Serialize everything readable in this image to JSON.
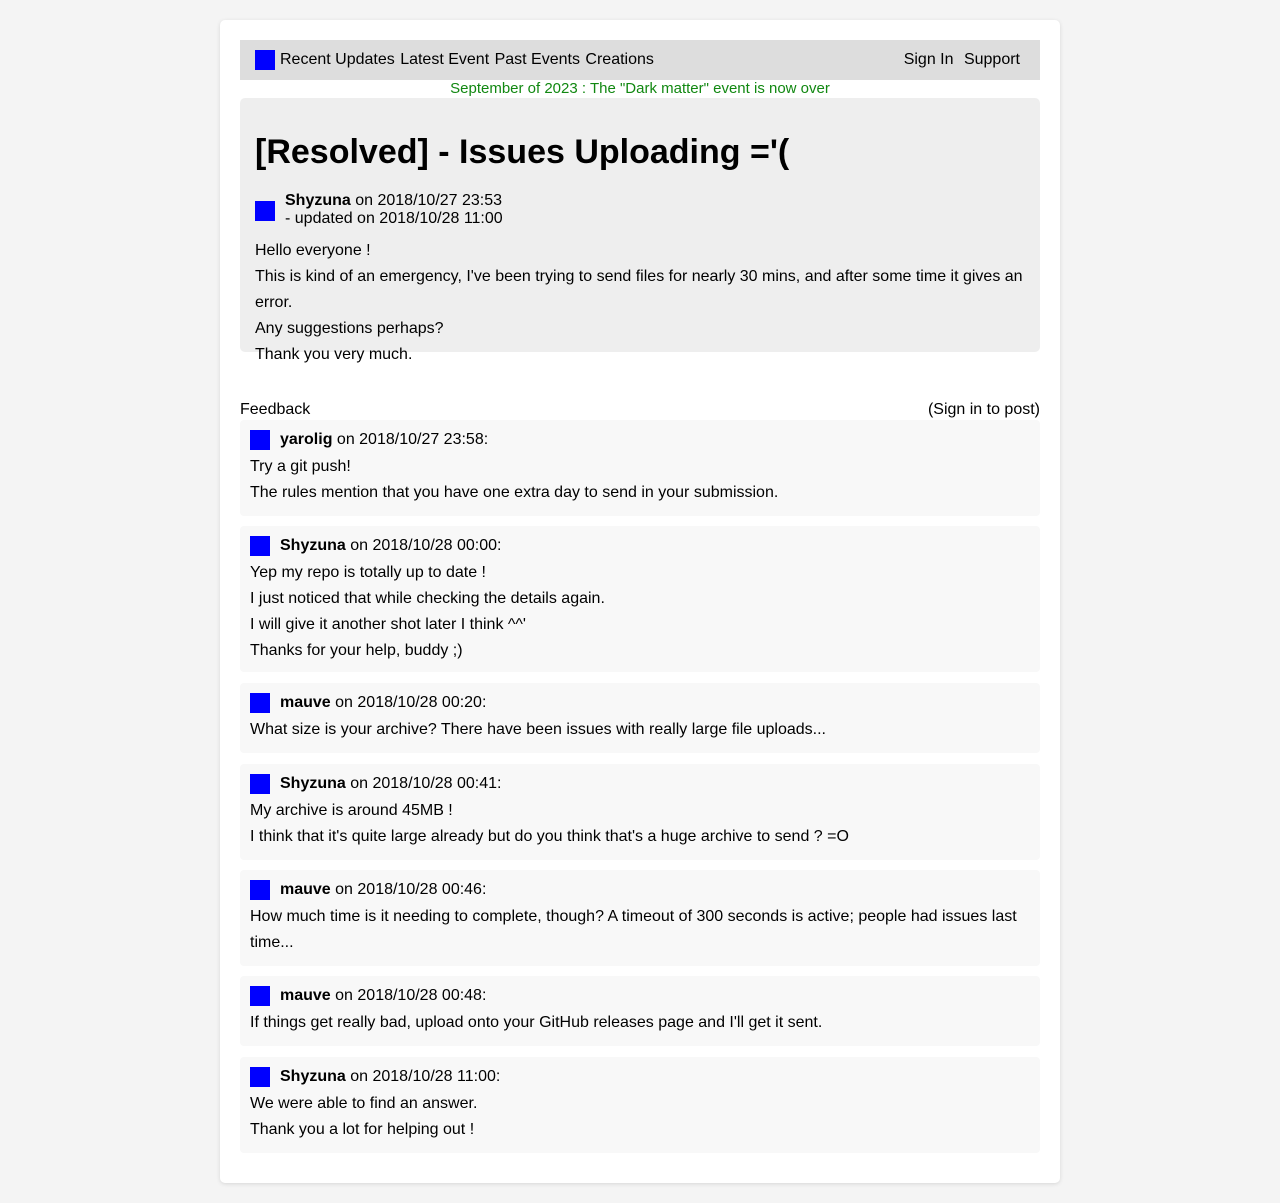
{
  "nav": {
    "links": [
      "Recent Updates",
      "Latest Event",
      "Past Events",
      "Creations"
    ],
    "right": [
      "Sign In",
      "Support"
    ],
    "logo_icon": "site-logo-square",
    "colors": {
      "bar": "#dddddd",
      "logo": "#0000ff"
    }
  },
  "banner": {
    "text": "September of 2023 : The \"Dark matter\" event is now over",
    "color": "#118811"
  },
  "post": {
    "title": "[Resolved] - Issues Uploading ='(",
    "author": "Shyzuna",
    "posted": " on 2018/10/27 23:53",
    "updated": "- updated on 2018/10/28 11:00",
    "body": [
      "Hello everyone !",
      "This is kind of an emergency, I've been trying to send files for nearly 30 mins, and after some time it gives an error.",
      "Any suggestions perhaps?",
      "Thank you very much."
    ]
  },
  "feedback": {
    "label": "Feedback",
    "sign_in": "(Sign in to post)"
  },
  "comments": [
    {
      "author": "yarolig",
      "meta": " on 2018/10/27 23:58:",
      "lines": [
        "Try a git push!",
        "The rules mention that you have one extra day to send in your submission."
      ]
    },
    {
      "author": "Shyzuna",
      "meta": " on 2018/10/28 00:00:",
      "lines": [
        "Yep my repo is totally up to date !",
        "I just noticed that while checking the details again.",
        "I will give it another shot later I think ^^'",
        "Thanks for your help, buddy ;)"
      ]
    },
    {
      "author": "mauve",
      "meta": " on 2018/10/28 00:20:",
      "lines": [
        "What size is your archive? There have been issues with really large file uploads..."
      ]
    },
    {
      "author": "Shyzuna",
      "meta": " on 2018/10/28 00:41:",
      "lines": [
        "My archive is around 45MB !",
        "I think that it's quite large already but do you think that's a huge archive to send ? =O"
      ]
    },
    {
      "author": "mauve",
      "meta": " on 2018/10/28 00:46:",
      "lines": [
        "How much time is it needing to complete, though? A timeout of 300 seconds is active; people had issues last time..."
      ]
    },
    {
      "author": "mauve",
      "meta": " on 2018/10/28 00:48:",
      "lines": [
        "If things get really bad, upload onto your GitHub releases page and I'll get it sent."
      ]
    },
    {
      "author": "Shyzuna",
      "meta": " on 2018/10/28 11:00:",
      "lines": [
        "We were able to find an answer.",
        "Thank you a lot for helping out !"
      ]
    }
  ]
}
